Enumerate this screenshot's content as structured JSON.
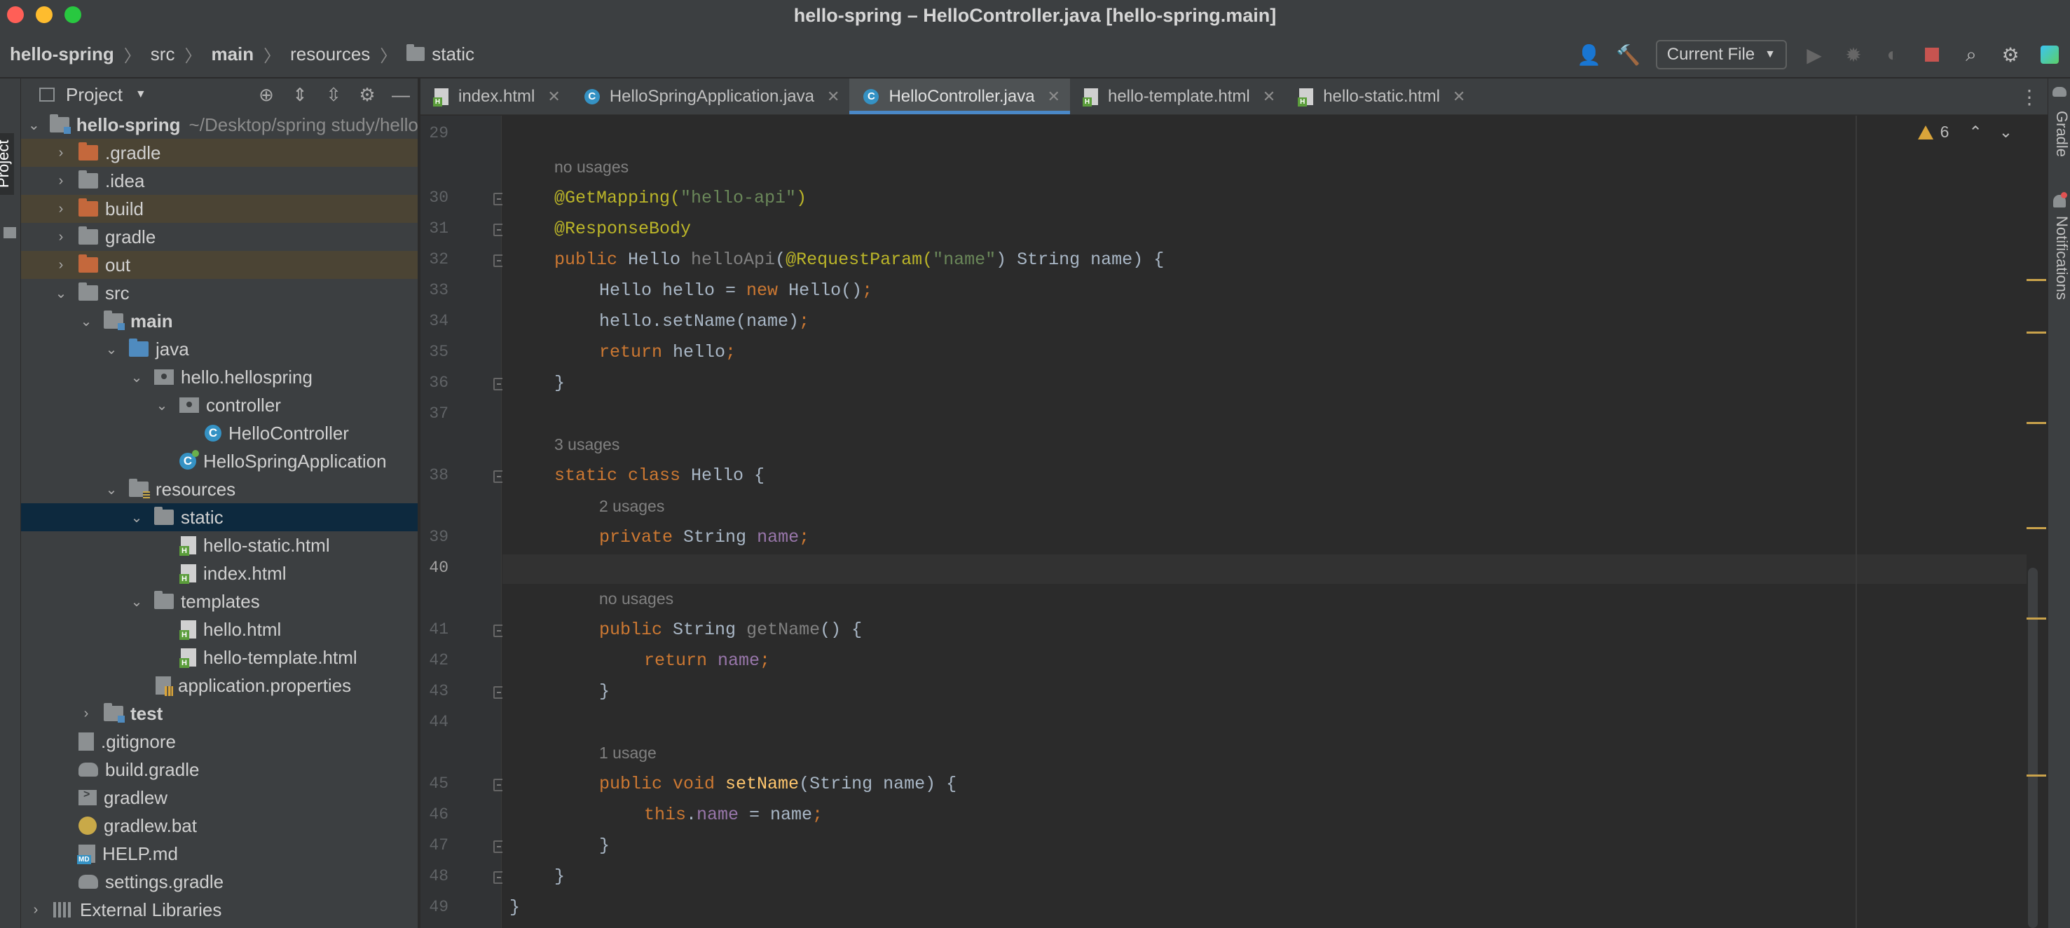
{
  "window": {
    "title": "hello-spring – HelloController.java [hello-spring.main]"
  },
  "navbar": {
    "breadcrumbs": [
      "hello-spring",
      "src",
      "main",
      "resources",
      "static"
    ],
    "run_config": "Current File"
  },
  "left_strip": {
    "project_label": "Project"
  },
  "right_strip": {
    "gradle_label": "Gradle",
    "notifications_label": "Notifications"
  },
  "project_panel": {
    "title": "Project",
    "tree": [
      {
        "label": "hello-spring",
        "extra": "~/Desktop/spring study/hello-spring",
        "bold": true
      },
      {
        "label": ".gradle"
      },
      {
        "label": ".idea"
      },
      {
        "label": "build"
      },
      {
        "label": "gradle"
      },
      {
        "label": "out"
      },
      {
        "label": "src"
      },
      {
        "label": "main",
        "bold": true
      },
      {
        "label": "java"
      },
      {
        "label": "hello.hellospring"
      },
      {
        "label": "controller"
      },
      {
        "label": "HelloController"
      },
      {
        "label": "HelloSpringApplication"
      },
      {
        "label": "resources"
      },
      {
        "label": "static"
      },
      {
        "label": "hello-static.html"
      },
      {
        "label": "index.html"
      },
      {
        "label": "templates"
      },
      {
        "label": "hello.html"
      },
      {
        "label": "hello-template.html"
      },
      {
        "label": "application.properties"
      },
      {
        "label": "test",
        "bold": true
      },
      {
        "label": ".gitignore"
      },
      {
        "label": "build.gradle"
      },
      {
        "label": "gradlew"
      },
      {
        "label": "gradlew.bat"
      },
      {
        "label": "HELP.md"
      },
      {
        "label": "settings.gradle"
      },
      {
        "label": "External Libraries"
      }
    ]
  },
  "tabs": [
    {
      "label": "index.html",
      "icon": "html-file-icon",
      "active": false
    },
    {
      "label": "HelloSpringApplication.java",
      "icon": "class-icon",
      "active": false
    },
    {
      "label": "HelloController.java",
      "icon": "class-icon",
      "active": true
    },
    {
      "label": "hello-template.html",
      "icon": "html-file-icon",
      "active": false
    },
    {
      "label": "hello-static.html",
      "icon": "html-file-icon",
      "active": false
    }
  ],
  "editor": {
    "warning_count": "6",
    "current_line": "40",
    "line_numbers": [
      "29",
      "30",
      "31",
      "32",
      "33",
      "34",
      "35",
      "36",
      "37",
      "38",
      "39",
      "40",
      "41",
      "42",
      "43",
      "44",
      "45",
      "46",
      "47",
      "48",
      "49"
    ],
    "inlay_hints": [
      "no usages",
      "3 usages",
      "2 usages",
      "no usages",
      "1 usage"
    ],
    "code": {
      "l30": [
        "@GetMapping(",
        "\"hello-api\"",
        ")"
      ],
      "l31": [
        "@ResponseBody"
      ],
      "l32": [
        "public ",
        "Hello ",
        "helloApi",
        "(",
        "@RequestParam(",
        "\"name\"",
        ") String name) {"
      ],
      "l33": [
        "Hello hello = ",
        "new ",
        "Hello()",
        ";"
      ],
      "l34": [
        "hello.setName(name)",
        ";"
      ],
      "l35": [
        "return ",
        "hello",
        ";"
      ],
      "l36": [
        "}"
      ],
      "l38": [
        "static class ",
        "Hello {"
      ],
      "l39": [
        "private ",
        "String ",
        "name",
        ";"
      ],
      "l41": [
        "public ",
        "String ",
        "getName",
        "() {"
      ],
      "l42": [
        "return ",
        "name",
        ";"
      ],
      "l43": [
        "}"
      ],
      "l45": [
        "public void ",
        "setName",
        "(String name) {"
      ],
      "l46": [
        "this",
        ".",
        "name",
        " = name",
        ";"
      ],
      "l47": [
        "}"
      ],
      "l48": [
        "}"
      ],
      "l49": [
        "}"
      ]
    }
  },
  "colors": {
    "keyword": "#cc7832",
    "annotation": "#bbb529",
    "string": "#6a8759",
    "field": "#9876aa",
    "method": "#ffc66d",
    "selection": "#0d293e",
    "tab_underline": "#4a88c7"
  }
}
